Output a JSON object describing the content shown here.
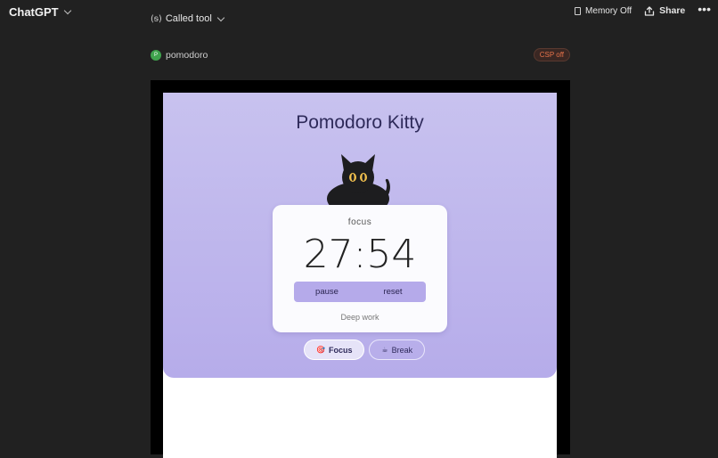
{
  "header": {
    "brand": "ChatGPT",
    "called_tool": "Called tool",
    "memory": "Memory Off",
    "share": "Share",
    "more": "•••"
  },
  "tool": {
    "badge": "P",
    "name": "pomodoro",
    "csp": "CSP off"
  },
  "widget": {
    "title": "Pomodoro Kitty",
    "mode": "focus",
    "time": "27:54",
    "pause_label": "pause",
    "reset_label": "reset",
    "session_label": "Deep work",
    "tabs": [
      {
        "emoji": "🎯",
        "label": "Focus",
        "active": true
      },
      {
        "emoji": "☕",
        "label": "Break",
        "active": false
      }
    ]
  },
  "colors": {
    "background": "#212121",
    "card_top": "#c8c2ef",
    "card_bottom": "#b6acea",
    "controls": "#b5aaea",
    "csp_text": "#e8734a",
    "badge_green": "#3fa34d"
  }
}
